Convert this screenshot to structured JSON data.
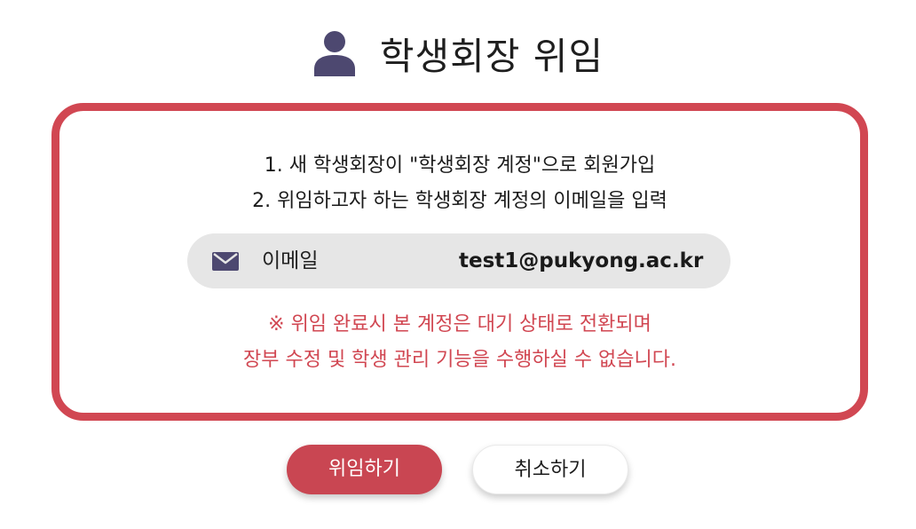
{
  "header": {
    "title": "학생회장 위임",
    "icon": "user-icon"
  },
  "instructions": {
    "line1": "1. 새 학생회장이 \"학생회장 계정\"으로 회원가입",
    "line2": "2. 위임하고자 하는 학생회장 계정의 이메일을 입력"
  },
  "email_field": {
    "icon": "mail-icon",
    "label": "이메일",
    "value": "test1@pukyong.ac.kr"
  },
  "warning": {
    "line1": "※ 위임 완료시 본 계정은 대기 상태로 전환되며",
    "line2": "장부 수정 및 학생 관리 기능을 수행하실 수 없습니다."
  },
  "buttons": {
    "delegate_label": "위임하기",
    "cancel_label": "취소하기"
  },
  "colors": {
    "accent": "#d14752",
    "pill_background": "#e6e6e6",
    "icon": "#4d4870"
  }
}
